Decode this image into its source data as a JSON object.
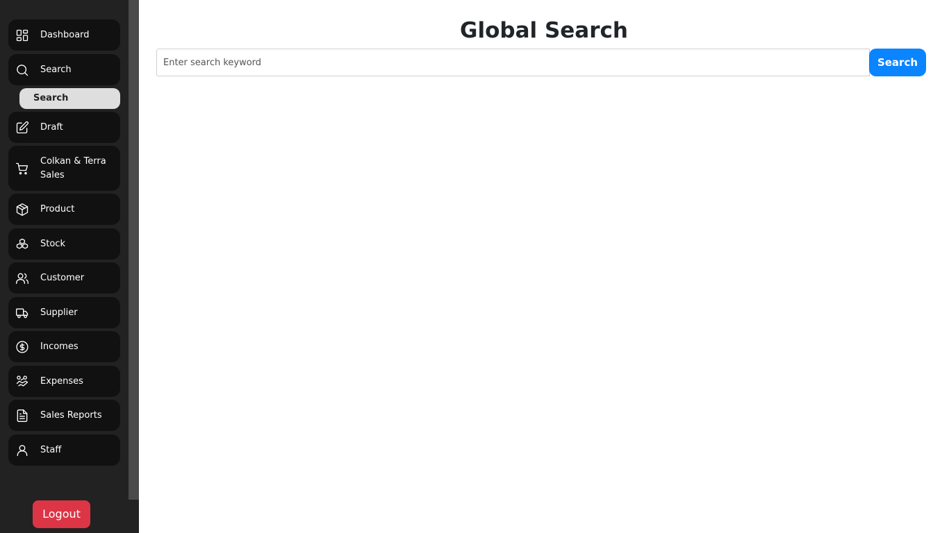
{
  "sidebar": {
    "items": [
      {
        "label": "Dashboard",
        "icon": "dashboard-icon"
      },
      {
        "label": "Search",
        "icon": "search-icon"
      },
      {
        "label": "Draft",
        "icon": "edit-icon"
      },
      {
        "label": "Colkan & Terra Sales",
        "icon": "cart-icon"
      },
      {
        "label": "Product",
        "icon": "box-icon"
      },
      {
        "label": "Stock",
        "icon": "boxes-icon"
      },
      {
        "label": "Customer",
        "icon": "users-icon"
      },
      {
        "label": "Supplier",
        "icon": "truck-icon"
      },
      {
        "label": "Incomes",
        "icon": "dollar-circle-icon"
      },
      {
        "label": "Expenses",
        "icon": "hand-coins-icon"
      },
      {
        "label": "Sales Reports",
        "icon": "document-icon"
      },
      {
        "label": "Staff",
        "icon": "user-icon"
      }
    ],
    "search_subitem": "Search",
    "logout_label": "Logout"
  },
  "main": {
    "title": "Global Search",
    "search_placeholder": "Enter search keyword",
    "search_button": "Search"
  },
  "colors": {
    "sidebar_bg": "#222222",
    "nav_item_bg": "#111111",
    "accent": "#0b84ff",
    "logout": "#dc3545"
  }
}
